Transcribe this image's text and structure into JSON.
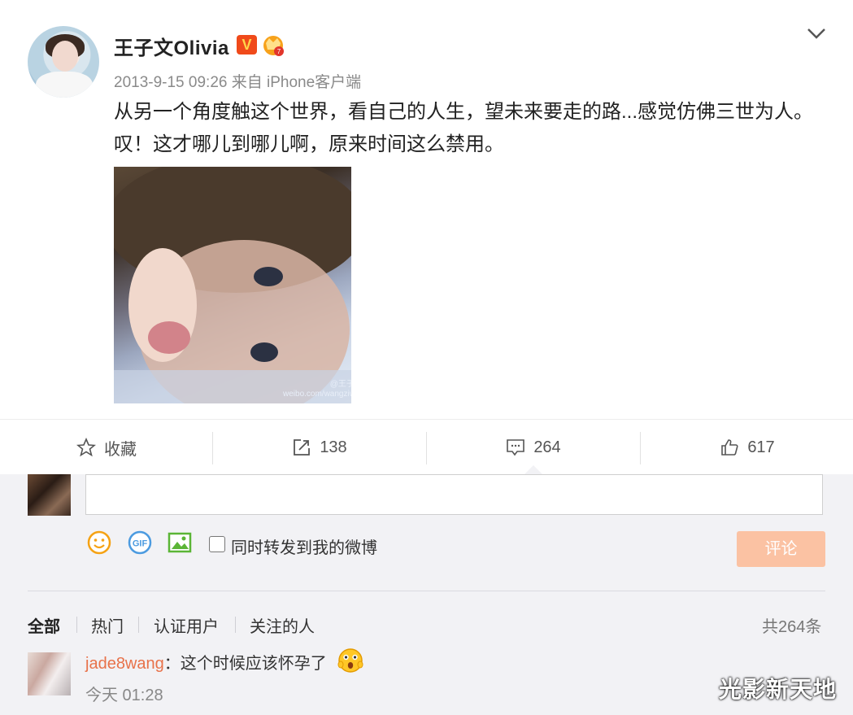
{
  "post": {
    "username": "王子文Olivia",
    "verified_badge": "V",
    "meta": "2013-9-15 09:26 来自 iPhone客户端",
    "content": "从另一个角度触这个世界，看自己的人生，望未来要走的路...感觉仿佛三世为人。叹！这才哪儿到哪儿啊，原来时间这么禁用。",
    "image_watermark_line1": "@王子文Olivia",
    "image_watermark_line2": "weibo.com/wangziwenolivia"
  },
  "actions": {
    "favorite_label": "收藏",
    "repost_count": "138",
    "comment_count": "264",
    "like_count": "617"
  },
  "composer": {
    "repost_checkbox_label": "同时转发到我的微博",
    "submit_label": "评论",
    "submit_color": "#fbc2a3"
  },
  "comments": {
    "filters": [
      "全部",
      "热门",
      "认证用户",
      "关注的人"
    ],
    "total": "共264条",
    "items": [
      {
        "user": "jade8wang",
        "text": "：这个时候应该怀孕了",
        "time": "今天 01:28"
      }
    ]
  },
  "watermark": "光影新天地",
  "colors": {
    "username_link": "#e8724a",
    "badge": "#f04a1a",
    "comment_bg": "#f2f2f5"
  }
}
